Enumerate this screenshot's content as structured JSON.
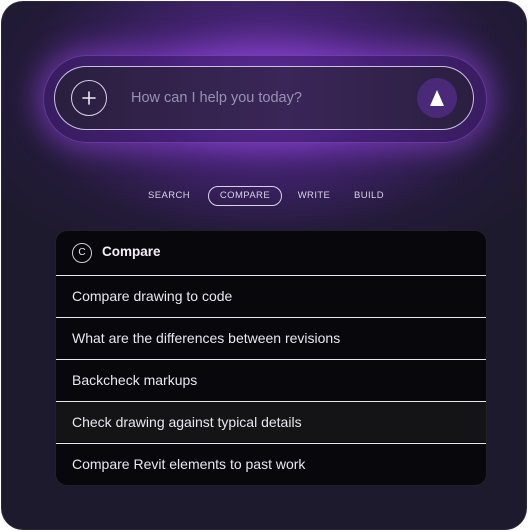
{
  "prompt": {
    "placeholder": "How can I help you today?",
    "value": ""
  },
  "icons": {
    "add": "plus-icon",
    "send": "arrow-up-triangle-icon",
    "panel": "c-circle-icon"
  },
  "tabs": [
    {
      "label": "SEARCH",
      "active": false
    },
    {
      "label": "COMPARE",
      "active": true
    },
    {
      "label": "WRITE",
      "active": false
    },
    {
      "label": "BUILD",
      "active": false
    }
  ],
  "panel": {
    "badge": "C",
    "title": "Compare",
    "options": [
      {
        "label": "Compare drawing to code"
      },
      {
        "label": "What are the differences between revisions"
      },
      {
        "label": "Backcheck markups"
      },
      {
        "label": "Check drawing against typical details",
        "highlighted": true
      },
      {
        "label": "Compare Revit elements to past work"
      }
    ]
  },
  "colors": {
    "background": "#1e1a2e",
    "glow": "#9646e6",
    "send_button": "#4a2a78",
    "panel_bg": "#08070b",
    "text": "#e9e7ef"
  }
}
